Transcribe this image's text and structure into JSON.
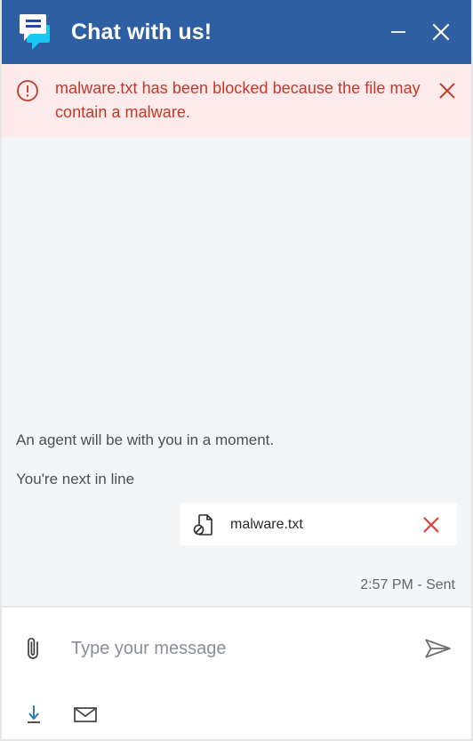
{
  "window": {
    "title": "Chat with us!",
    "brand_color": "#2e5fa3",
    "logo_icon": "chat-bubbles-icon",
    "minimize_icon": "minimize-icon",
    "close_icon": "close-icon"
  },
  "alert": {
    "icon": "alert-circle-icon",
    "message": "malware.txt has been blocked because the file may contain a malware.",
    "close_icon": "close-icon",
    "text_color": "#c0392b",
    "background_color": "#fdeaea"
  },
  "messages": {
    "system_1": "An agent will be with you in a moment.",
    "system_2": "You're next in line",
    "attachment": {
      "icon": "blocked-file-icon",
      "file_name": "malware.txt",
      "remove_icon": "close-icon",
      "remove_color": "#e53935"
    },
    "status": "2:57 PM - Sent"
  },
  "composer": {
    "attach_icon": "paperclip-icon",
    "placeholder": "Type your message",
    "value": "",
    "send_icon": "send-paper-plane-icon"
  },
  "footer": {
    "download_icon": "download-transcript-icon",
    "download_color": "#1f74b5",
    "email_icon": "email-transcript-icon",
    "email_color": "#3f3f3f"
  }
}
